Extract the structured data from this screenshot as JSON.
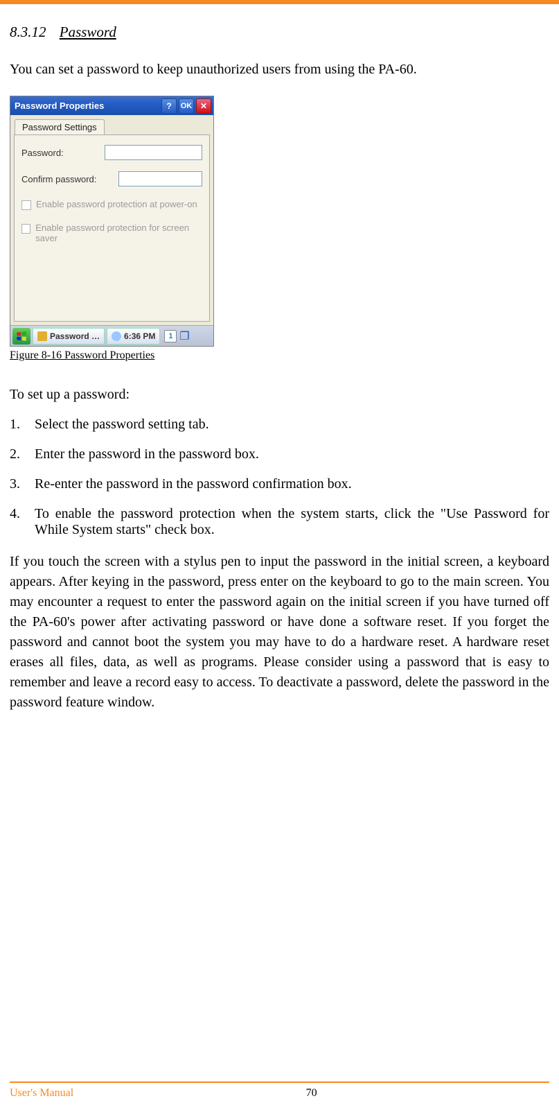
{
  "heading": {
    "number": "8.3.12",
    "title": "Password"
  },
  "intro": "You can set a password to keep unauthorized users from using the PA-60.",
  "screenshot": {
    "window_title": "Password Properties",
    "buttons": {
      "help": "?",
      "ok": "OK",
      "close": "✕"
    },
    "tab": "Password Settings",
    "fields": {
      "password_label": "Password:",
      "confirm_label": "Confirm password:"
    },
    "checks": {
      "poweron": "Enable password protection at power-on",
      "screensaver": "Enable password protection for screen saver"
    },
    "taskbar": {
      "item": "Password …",
      "time": "6:36 PM",
      "sip": "1"
    }
  },
  "figure_caption": "Figure 8-16 Password Properties",
  "steps_intro": "To set up a password:",
  "steps": [
    "Select the password setting tab.",
    "Enter the password in the password box.",
    "Re-enter the password in the password confirmation box.",
    "To enable the password protection when the system starts, click the \"Use Password for While System starts\" check box."
  ],
  "body_para": "If you touch the screen with a stylus pen to input the password in the initial screen, a keyboard appears. After keying in the password, press enter on the keyboard to go to the main screen. You may encounter a request to enter the password again on the initial screen if you have turned off the PA-60's power after activating password or have done a software reset. If you forget the password and cannot boot the system you may have to do a hardware reset. A hardware reset erases all files, data, as well as programs. Please consider using a password that is easy to remember and leave a record easy to access. To deactivate a password, delete the password in the password feature window.",
  "footer": {
    "label": "User's Manual",
    "page": "70"
  }
}
